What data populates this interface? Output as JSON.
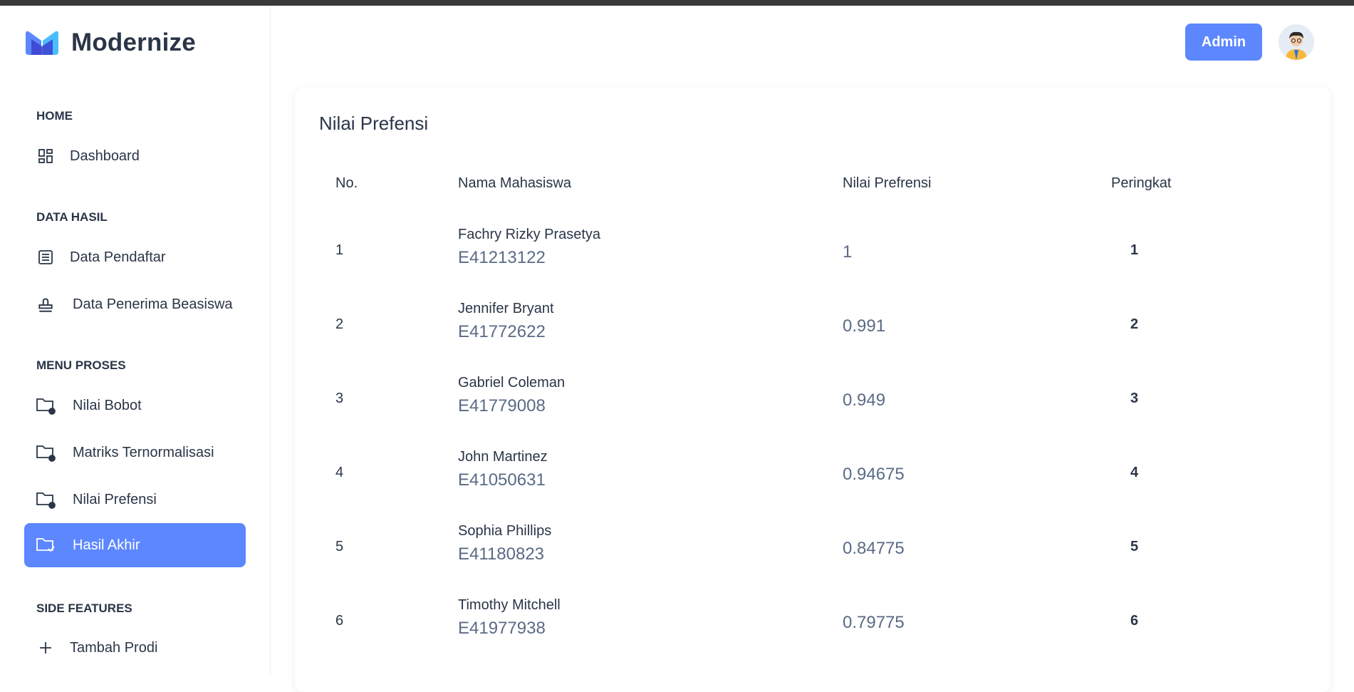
{
  "brand": {
    "name": "Modernize",
    "accent": "#5d87ff"
  },
  "header": {
    "admin_label": "Admin"
  },
  "sidebar": {
    "sections": {
      "home": "HOME",
      "data_hasil": "DATA HASIL",
      "menu_proses": "MENU PROSES",
      "side_features": "SIDE FEATURES"
    },
    "items": [
      {
        "label": "Dashboard",
        "icon": "dashboard-icon"
      },
      {
        "label": "Data Pendaftar",
        "icon": "list-icon"
      },
      {
        "label": "Data Penerima Beasiswa",
        "icon": "stamp-icon"
      },
      {
        "label": "Nilai Bobot",
        "icon": "folder-icon"
      },
      {
        "label": "Matriks Ternormalisasi",
        "icon": "folder-icon"
      },
      {
        "label": "Nilai Prefensi",
        "icon": "folder-icon"
      },
      {
        "label": "Hasil Akhir",
        "icon": "folder-check-icon",
        "active": true
      },
      {
        "label": "Tambah Prodi",
        "icon": "plus-icon"
      }
    ]
  },
  "main": {
    "card_title": "Nilai Prefensi",
    "columns": [
      "No.",
      "Nama Mahasiswa",
      "Nilai Prefrensi",
      "Peringkat"
    ],
    "rows": [
      {
        "no": "1",
        "name": "Fachry Rizky Prasetya",
        "nim": "E41213122",
        "score": "1",
        "rank": "1"
      },
      {
        "no": "2",
        "name": "Jennifer Bryant",
        "nim": "E41772622",
        "score": "0.991",
        "rank": "2"
      },
      {
        "no": "3",
        "name": "Gabriel Coleman",
        "nim": "E41779008",
        "score": "0.949",
        "rank": "3"
      },
      {
        "no": "4",
        "name": "John Martinez",
        "nim": "E41050631",
        "score": "0.94675",
        "rank": "4"
      },
      {
        "no": "5",
        "name": "Sophia Phillips",
        "nim": "E41180823",
        "score": "0.84775",
        "rank": "5"
      },
      {
        "no": "6",
        "name": "Timothy Mitchell",
        "nim": "E41977938",
        "score": "0.79775",
        "rank": "6"
      }
    ]
  }
}
